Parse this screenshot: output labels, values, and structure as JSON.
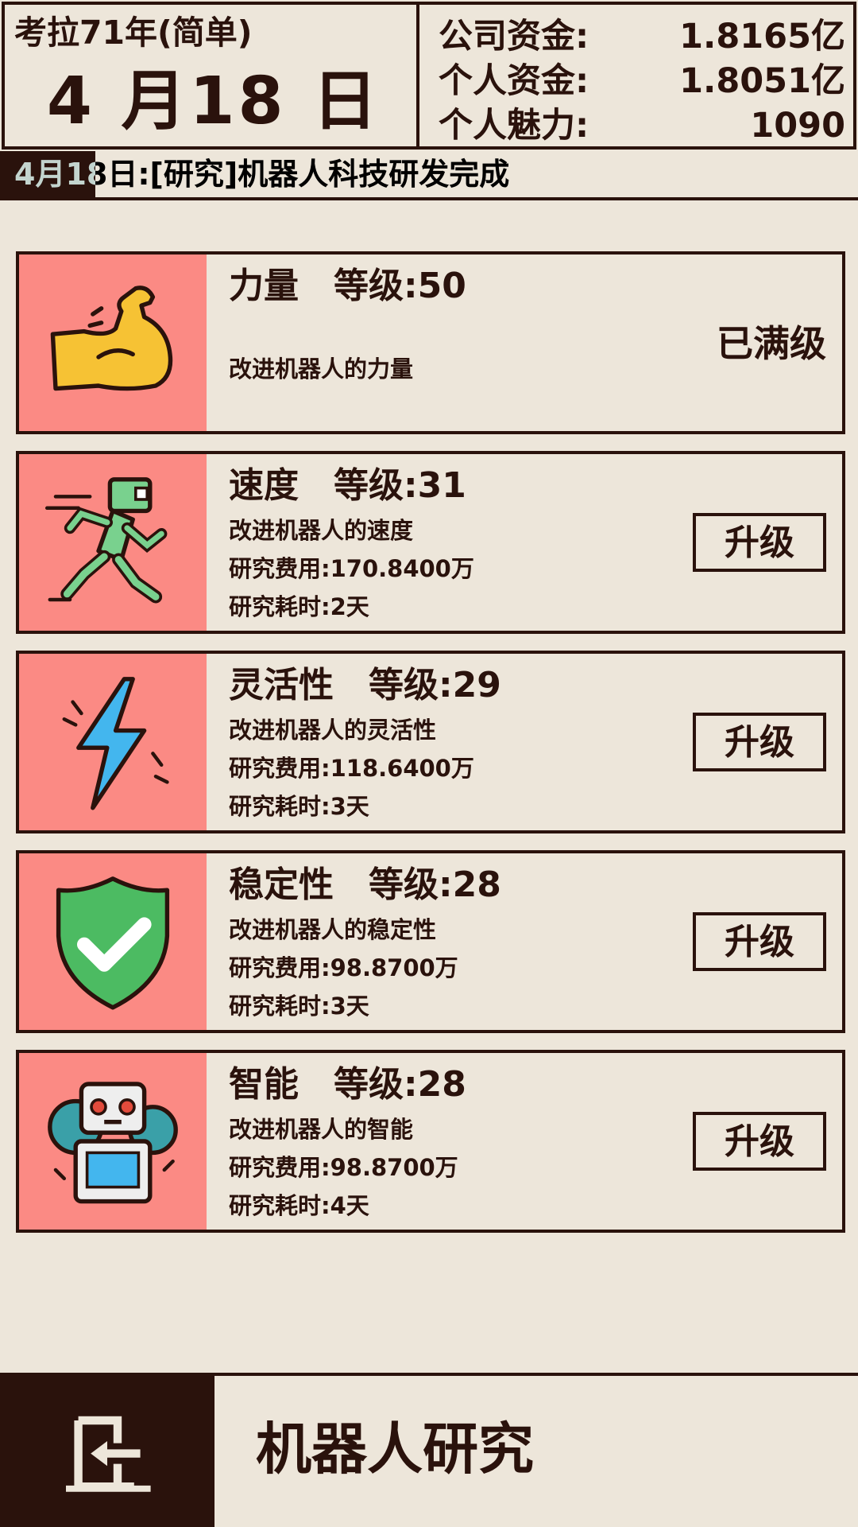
{
  "header": {
    "game_mode": "考拉71年(简单)",
    "date": "4 月18 日",
    "company_funds_label": "公司资金:",
    "company_funds_value": "1.8165亿",
    "personal_funds_label": "个人资金:",
    "personal_funds_value": "1.8051亿",
    "charm_label": "个人魅力:",
    "charm_value": "1090"
  },
  "ticker": {
    "text": "4月18日:[研究]机器人科技研发完成"
  },
  "research": [
    {
      "title": "力量　等级:50",
      "description": "改进机器人的力量",
      "status": "已满级",
      "icon": "flexed-arm-icon"
    },
    {
      "title": "速度　等级:31",
      "description": "改进机器人的速度",
      "cost": "研究费用:170.8400万",
      "duration": "研究耗时:2天",
      "button": "升级",
      "icon": "running-robot-icon"
    },
    {
      "title": "灵活性　等级:29",
      "description": "改进机器人的灵活性",
      "cost": "研究费用:118.6400万",
      "duration": "研究耗时:3天",
      "button": "升级",
      "icon": "lightning-bolt-icon"
    },
    {
      "title": "稳定性　等级:28",
      "description": "改进机器人的稳定性",
      "cost": "研究费用:98.8700万",
      "duration": "研究耗时:3天",
      "button": "升级",
      "icon": "shield-check-icon"
    },
    {
      "title": "智能　等级:28",
      "description": "改进机器人的智能",
      "cost": "研究费用:98.8700万",
      "duration": "研究耗时:4天",
      "button": "升级",
      "icon": "robot-gear-icon"
    }
  ],
  "footer": {
    "title": "机器人研究",
    "back_icon": "exit-icon"
  },
  "colors": {
    "background": "#ede6da",
    "ink": "#2a120c",
    "icon_panel": "#fb8a84"
  }
}
